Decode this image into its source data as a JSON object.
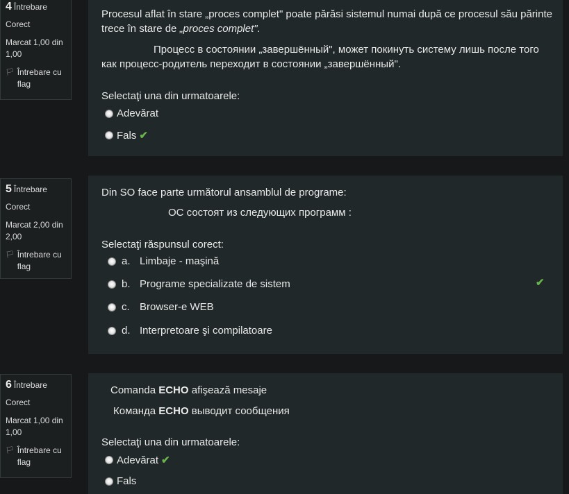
{
  "q4": {
    "number": "4",
    "word": "Întrebare",
    "status": "Corect",
    "mark": "Marcat 1,00 din 1,00",
    "flag": "Întrebare cu flag",
    "text_ro_1": "Procesul aflat în stare „proces complet\" poate părăsi sistemul numai după ce procesul său părinte",
    "text_ro_2": "trece în stare de ",
    "text_ro_2_italic": "„proces complet\".",
    "text_ru_1": "Процесс в состоянии  „завершённый\", может покинуть систему лишь после того",
    "text_ru_2": "как процесс-родитель переходит в состоянии „завершённый\".",
    "prompt": "Selectaţi una din urmatoarele:",
    "options": [
      "Adevărat",
      "Fals"
    ]
  },
  "q5": {
    "number": "5",
    "word": "Întrebare",
    "status": "Corect",
    "mark": "Marcat 2,00 din 2,00",
    "flag": "Întrebare cu flag",
    "text_ro": "Din SO face parte următorul ansamblul de programe:",
    "text_ru": "ОС состоят из следующих программ :",
    "prompt": "Selectaţi răspunsul corect:",
    "options": [
      {
        "letter": "a.",
        "label": "Limbaje - maşină"
      },
      {
        "letter": "b.",
        "label": "Programe specializate de sistem"
      },
      {
        "letter": "c.",
        "label": "Browser-e  WEB"
      },
      {
        "letter": "d.",
        "label": "Interpretoare şi compilatoare"
      }
    ]
  },
  "q6": {
    "number": "6",
    "word": "Întrebare",
    "status": "Corect",
    "mark": "Marcat 1,00 din 1,00",
    "flag": "Întrebare cu flag",
    "text_ro_pre": "Comanda ",
    "text_ro_bold": "ECHO",
    "text_ro_post": " afişează mesaje",
    "text_ru_pre": "Команда  ",
    "text_ru_bold": "ECHO",
    "text_ru_post": " выводит сообщения",
    "prompt": "Selectaţi una din urmatoarele:",
    "options": [
      "Adevărat",
      "Fals"
    ]
  },
  "icons": {
    "check": "check-icon",
    "flag": "flag-icon",
    "radio": "radio-icon"
  },
  "colors": {
    "check": "#6ab44e",
    "background": "#161819",
    "panel": "#202829"
  }
}
